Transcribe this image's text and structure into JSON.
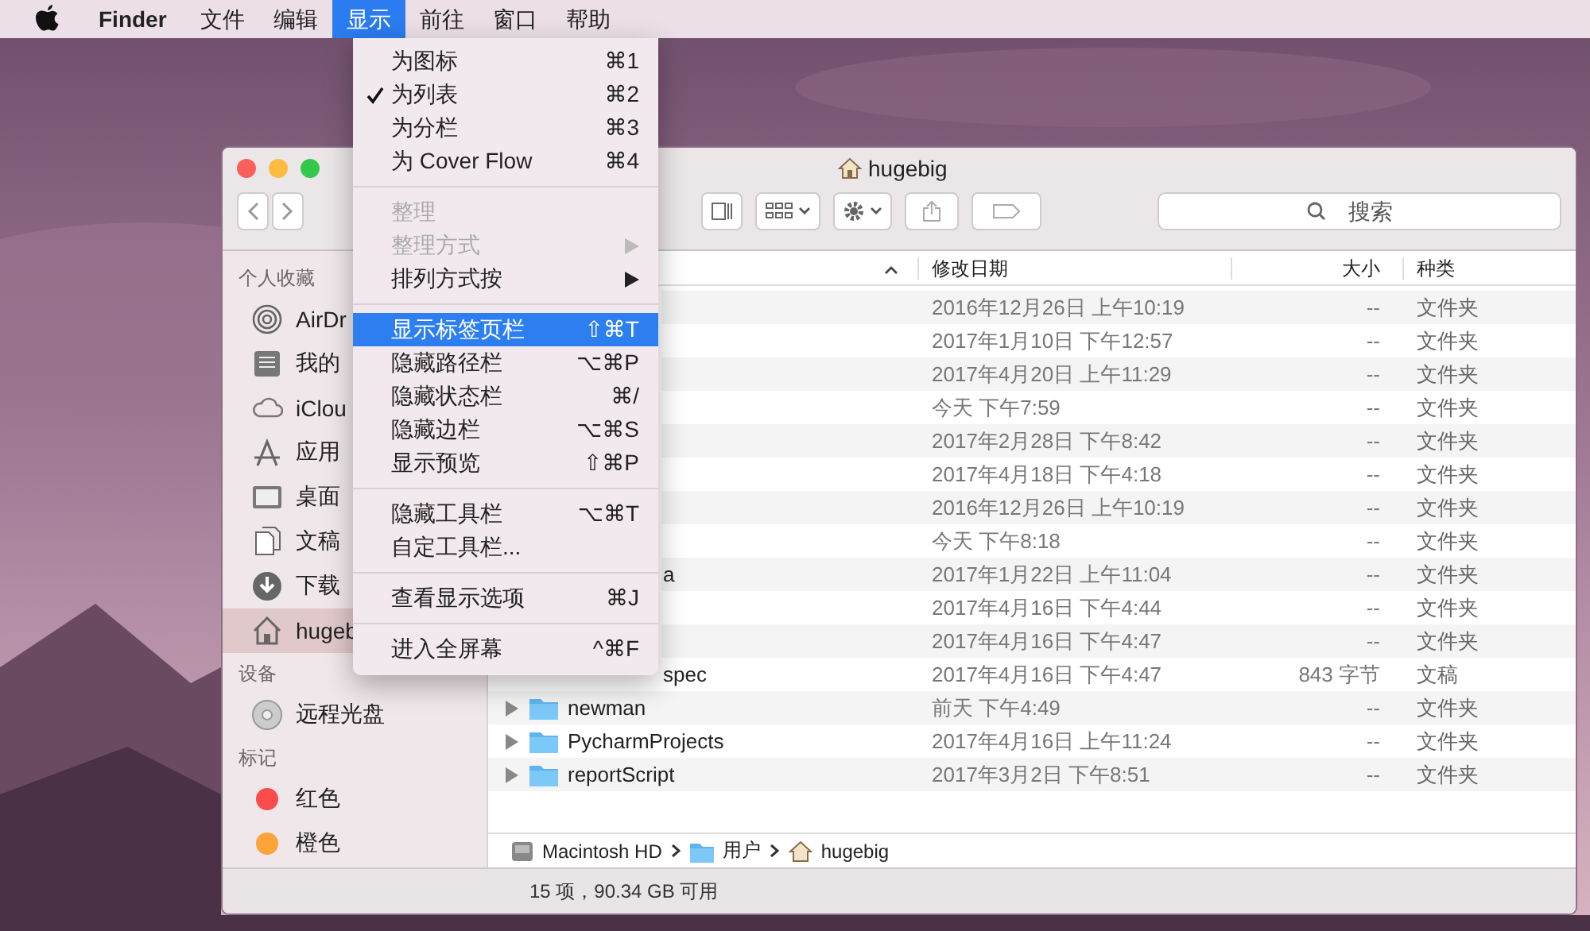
{
  "menubar": {
    "app": "Finder",
    "menus": [
      {
        "label": "文件",
        "selected": false
      },
      {
        "label": "编辑",
        "selected": false
      },
      {
        "label": "显示",
        "selected": true
      },
      {
        "label": "前往",
        "selected": false
      },
      {
        "label": "窗口",
        "selected": false
      },
      {
        "label": "帮助",
        "selected": false
      }
    ]
  },
  "menu": {
    "items": [
      {
        "kind": "item",
        "label": "为图标",
        "shortcut": "⌘1",
        "checked": false,
        "disabled": false,
        "submenu": false,
        "selected": false
      },
      {
        "kind": "item",
        "label": "为列表",
        "shortcut": "⌘2",
        "checked": true,
        "disabled": false,
        "submenu": false,
        "selected": false
      },
      {
        "kind": "item",
        "label": "为分栏",
        "shortcut": "⌘3",
        "checked": false,
        "disabled": false,
        "submenu": false,
        "selected": false
      },
      {
        "kind": "item",
        "label": "为 Cover Flow",
        "shortcut": "⌘4",
        "checked": false,
        "disabled": false,
        "submenu": false,
        "selected": false
      },
      {
        "kind": "separator"
      },
      {
        "kind": "item",
        "label": "整理",
        "checked": false,
        "disabled": true,
        "submenu": false,
        "selected": false
      },
      {
        "kind": "item",
        "label": "整理方式",
        "checked": false,
        "disabled": true,
        "submenu": true,
        "selected": false
      },
      {
        "kind": "item",
        "label": "排列方式按",
        "checked": false,
        "disabled": false,
        "submenu": true,
        "selected": false
      },
      {
        "kind": "separator"
      },
      {
        "kind": "item",
        "label": "显示标签页栏",
        "shortcut": "⇧⌘T",
        "checked": false,
        "disabled": false,
        "submenu": false,
        "selected": true
      },
      {
        "kind": "item",
        "label": "隐藏路径栏",
        "shortcut": "⌥⌘P",
        "checked": false,
        "disabled": false,
        "submenu": false,
        "selected": false
      },
      {
        "kind": "item",
        "label": "隐藏状态栏",
        "shortcut": "⌘/",
        "checked": false,
        "disabled": false,
        "submenu": false,
        "selected": false
      },
      {
        "kind": "item",
        "label": "隐藏边栏",
        "shortcut": "⌥⌘S",
        "checked": false,
        "disabled": false,
        "submenu": false,
        "selected": false
      },
      {
        "kind": "item",
        "label": "显示预览",
        "shortcut": "⇧⌘P",
        "checked": false,
        "disabled": false,
        "submenu": false,
        "selected": false
      },
      {
        "kind": "separator"
      },
      {
        "kind": "item",
        "label": "隐藏工具栏",
        "shortcut": "⌥⌘T",
        "checked": false,
        "disabled": false,
        "submenu": false,
        "selected": false
      },
      {
        "kind": "item",
        "label": "自定工具栏...",
        "checked": false,
        "disabled": false,
        "submenu": false,
        "selected": false
      },
      {
        "kind": "separator"
      },
      {
        "kind": "item",
        "label": "查看显示选项",
        "shortcut": "⌘J",
        "checked": false,
        "disabled": false,
        "submenu": false,
        "selected": false
      },
      {
        "kind": "separator"
      },
      {
        "kind": "item",
        "label": "进入全屏幕",
        "shortcut": "^⌘F",
        "checked": false,
        "disabled": false,
        "submenu": false,
        "selected": false
      }
    ]
  },
  "window": {
    "title": "hugebig",
    "search": {
      "placeholder": "搜索"
    }
  },
  "sidebar": {
    "sections": [
      {
        "title": "个人收藏",
        "items": [
          {
            "kind": "airdrop",
            "label": "AirDr",
            "selected": false
          },
          {
            "kind": "files",
            "label": "我的",
            "selected": false
          },
          {
            "kind": "cloud",
            "label": "iClou",
            "selected": false
          },
          {
            "kind": "apps",
            "label": "应用",
            "selected": false
          },
          {
            "kind": "desktop",
            "label": "桌面",
            "selected": false
          },
          {
            "kind": "docs",
            "label": "文稿",
            "selected": false
          },
          {
            "kind": "download",
            "label": "下载",
            "selected": false
          },
          {
            "kind": "home",
            "label": "hugeb",
            "selected": true
          }
        ]
      },
      {
        "title": "设备",
        "items": [
          {
            "kind": "disc",
            "label": "远程光盘",
            "selected": false
          }
        ]
      },
      {
        "title": "标记",
        "items": [
          {
            "kind": "tag",
            "label": "红色",
            "color": "#fc4b4b",
            "selected": false
          },
          {
            "kind": "tag",
            "label": "橙色",
            "color": "#fca43a",
            "selected": false
          }
        ]
      }
    ]
  },
  "table": {
    "columns": [
      "修改日期",
      "大小",
      "种类"
    ],
    "rows": [
      {
        "date": "2016年12月26日 上午10:19",
        "size": "--",
        "kind": "文件夹"
      },
      {
        "date": "2017年1月10日 下午12:57",
        "size": "--",
        "kind": "文件夹"
      },
      {
        "date": "2017年4月20日 上午11:29",
        "size": "--",
        "kind": "文件夹"
      },
      {
        "date": "今天 下午7:59",
        "size": "--",
        "kind": "文件夹"
      },
      {
        "date": "2017年2月28日 下午8:42",
        "size": "--",
        "kind": "文件夹"
      },
      {
        "date": "2017年4月18日 下午4:18",
        "size": "--",
        "kind": "文件夹"
      },
      {
        "date": "2016年12月26日 上午10:19",
        "size": "--",
        "kind": "文件夹"
      },
      {
        "date": "今天 下午8:18",
        "size": "--",
        "kind": "文件夹"
      },
      {
        "name": "a",
        "date": "2017年1月22日 上午11:04",
        "size": "--",
        "kind": "文件夹"
      },
      {
        "date": "2017年4月16日 下午4:44",
        "size": "--",
        "kind": "文件夹"
      },
      {
        "date": "2017年4月16日 下午4:47",
        "size": "--",
        "kind": "文件夹"
      },
      {
        "name": "spec",
        "date": "2017年4月16日 下午4:47",
        "size": "843 字节",
        "kind": "文稿"
      },
      {
        "name": "newman",
        "folder": true,
        "date": "前天 下午4:49",
        "size": "--",
        "kind": "文件夹"
      },
      {
        "name": "PycharmProjects",
        "folder": true,
        "date": "2017年4月16日 上午11:24",
        "size": "--",
        "kind": "文件夹"
      },
      {
        "name": "reportScript",
        "folder": true,
        "date": "2017年3月2日 下午8:51",
        "size": "--",
        "kind": "文件夹"
      }
    ]
  },
  "path_bar": [
    {
      "kind": "disk",
      "label": "Macintosh HD"
    },
    {
      "kind": "folder",
      "label": "用户"
    },
    {
      "kind": "home",
      "label": "hugebig"
    }
  ],
  "status_bar": "15 项，90.34 GB 可用"
}
